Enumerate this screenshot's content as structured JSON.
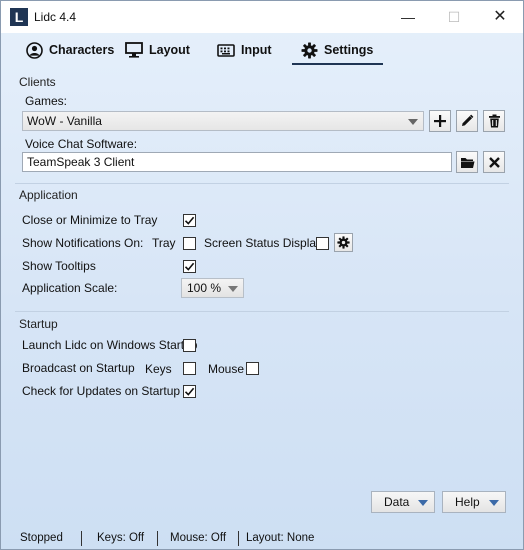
{
  "window": {
    "title": "Lidc 4.4",
    "app_icon_letter": "L"
  },
  "titlebar": {
    "minimize": "—",
    "maximize": "☐",
    "close": "✕"
  },
  "tabs": [
    {
      "label": "Characters",
      "icon": "user-circle-icon"
    },
    {
      "label": "Layout",
      "icon": "monitor-icon"
    },
    {
      "label": "Input",
      "icon": "keyboard-icon"
    },
    {
      "label": "Settings",
      "icon": "gear-icon",
      "active": true
    }
  ],
  "clients": {
    "section_title": "Clients",
    "games_label": "Games:",
    "games_selected": "WoW - Vanilla",
    "voice_label": "Voice Chat Software:",
    "voice_value": "TeamSpeak 3 Client"
  },
  "application": {
    "section_title": "Application",
    "close_minimize_label": "Close or Minimize to Tray",
    "close_minimize_checked": true,
    "notifications_label": "Show Notifications On:",
    "tray_label": "Tray",
    "tray_checked": false,
    "screen_status_label": "Screen Status Display",
    "screen_status_checked": false,
    "tooltips_label": "Show Tooltips",
    "tooltips_checked": true,
    "scale_label": "Application Scale:",
    "scale_value": "100 %"
  },
  "startup": {
    "section_title": "Startup",
    "launch_label": "Launch Lidc on Windows Startup",
    "launch_checked": false,
    "broadcast_label": "Broadcast on Startup",
    "keys_label": "Keys",
    "keys_checked": false,
    "mouse_label": "Mouse",
    "mouse_checked": false,
    "updates_label": "Check for Updates on Startup",
    "updates_checked": true
  },
  "footer": {
    "data_button": "Data",
    "help_button": "Help"
  },
  "status": {
    "state": "Stopped",
    "keys": "Keys: Off",
    "mouse": "Mouse: Off",
    "layout": "Layout: None"
  },
  "colors": {
    "accent": "#1f3554",
    "background": "#d7e5f6",
    "dropdown_arrow": "#3b6aa8"
  }
}
